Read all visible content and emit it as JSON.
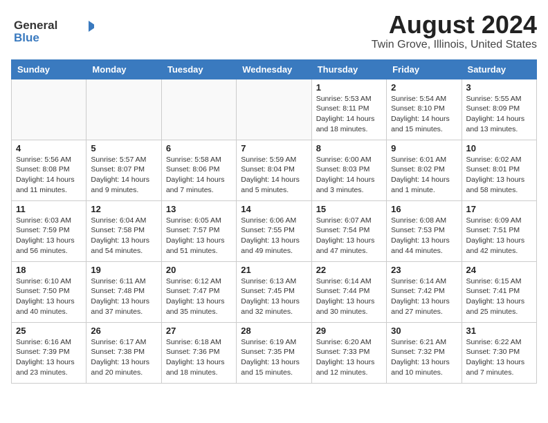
{
  "header": {
    "month_year": "August 2024",
    "location": "Twin Grove, Illinois, United States",
    "logo_general": "General",
    "logo_blue": "Blue"
  },
  "days_of_week": [
    "Sunday",
    "Monday",
    "Tuesday",
    "Wednesday",
    "Thursday",
    "Friday",
    "Saturday"
  ],
  "weeks": [
    [
      {
        "day": "",
        "info": ""
      },
      {
        "day": "",
        "info": ""
      },
      {
        "day": "",
        "info": ""
      },
      {
        "day": "",
        "info": ""
      },
      {
        "day": "1",
        "info": "Sunrise: 5:53 AM\nSunset: 8:11 PM\nDaylight: 14 hours\nand 18 minutes."
      },
      {
        "day": "2",
        "info": "Sunrise: 5:54 AM\nSunset: 8:10 PM\nDaylight: 14 hours\nand 15 minutes."
      },
      {
        "day": "3",
        "info": "Sunrise: 5:55 AM\nSunset: 8:09 PM\nDaylight: 14 hours\nand 13 minutes."
      }
    ],
    [
      {
        "day": "4",
        "info": "Sunrise: 5:56 AM\nSunset: 8:08 PM\nDaylight: 14 hours\nand 11 minutes."
      },
      {
        "day": "5",
        "info": "Sunrise: 5:57 AM\nSunset: 8:07 PM\nDaylight: 14 hours\nand 9 minutes."
      },
      {
        "day": "6",
        "info": "Sunrise: 5:58 AM\nSunset: 8:06 PM\nDaylight: 14 hours\nand 7 minutes."
      },
      {
        "day": "7",
        "info": "Sunrise: 5:59 AM\nSunset: 8:04 PM\nDaylight: 14 hours\nand 5 minutes."
      },
      {
        "day": "8",
        "info": "Sunrise: 6:00 AM\nSunset: 8:03 PM\nDaylight: 14 hours\nand 3 minutes."
      },
      {
        "day": "9",
        "info": "Sunrise: 6:01 AM\nSunset: 8:02 PM\nDaylight: 14 hours\nand 1 minute."
      },
      {
        "day": "10",
        "info": "Sunrise: 6:02 AM\nSunset: 8:01 PM\nDaylight: 13 hours\nand 58 minutes."
      }
    ],
    [
      {
        "day": "11",
        "info": "Sunrise: 6:03 AM\nSunset: 7:59 PM\nDaylight: 13 hours\nand 56 minutes."
      },
      {
        "day": "12",
        "info": "Sunrise: 6:04 AM\nSunset: 7:58 PM\nDaylight: 13 hours\nand 54 minutes."
      },
      {
        "day": "13",
        "info": "Sunrise: 6:05 AM\nSunset: 7:57 PM\nDaylight: 13 hours\nand 51 minutes."
      },
      {
        "day": "14",
        "info": "Sunrise: 6:06 AM\nSunset: 7:55 PM\nDaylight: 13 hours\nand 49 minutes."
      },
      {
        "day": "15",
        "info": "Sunrise: 6:07 AM\nSunset: 7:54 PM\nDaylight: 13 hours\nand 47 minutes."
      },
      {
        "day": "16",
        "info": "Sunrise: 6:08 AM\nSunset: 7:53 PM\nDaylight: 13 hours\nand 44 minutes."
      },
      {
        "day": "17",
        "info": "Sunrise: 6:09 AM\nSunset: 7:51 PM\nDaylight: 13 hours\nand 42 minutes."
      }
    ],
    [
      {
        "day": "18",
        "info": "Sunrise: 6:10 AM\nSunset: 7:50 PM\nDaylight: 13 hours\nand 40 minutes."
      },
      {
        "day": "19",
        "info": "Sunrise: 6:11 AM\nSunset: 7:48 PM\nDaylight: 13 hours\nand 37 minutes."
      },
      {
        "day": "20",
        "info": "Sunrise: 6:12 AM\nSunset: 7:47 PM\nDaylight: 13 hours\nand 35 minutes."
      },
      {
        "day": "21",
        "info": "Sunrise: 6:13 AM\nSunset: 7:45 PM\nDaylight: 13 hours\nand 32 minutes."
      },
      {
        "day": "22",
        "info": "Sunrise: 6:14 AM\nSunset: 7:44 PM\nDaylight: 13 hours\nand 30 minutes."
      },
      {
        "day": "23",
        "info": "Sunrise: 6:14 AM\nSunset: 7:42 PM\nDaylight: 13 hours\nand 27 minutes."
      },
      {
        "day": "24",
        "info": "Sunrise: 6:15 AM\nSunset: 7:41 PM\nDaylight: 13 hours\nand 25 minutes."
      }
    ],
    [
      {
        "day": "25",
        "info": "Sunrise: 6:16 AM\nSunset: 7:39 PM\nDaylight: 13 hours\nand 23 minutes."
      },
      {
        "day": "26",
        "info": "Sunrise: 6:17 AM\nSunset: 7:38 PM\nDaylight: 13 hours\nand 20 minutes."
      },
      {
        "day": "27",
        "info": "Sunrise: 6:18 AM\nSunset: 7:36 PM\nDaylight: 13 hours\nand 18 minutes."
      },
      {
        "day": "28",
        "info": "Sunrise: 6:19 AM\nSunset: 7:35 PM\nDaylight: 13 hours\nand 15 minutes."
      },
      {
        "day": "29",
        "info": "Sunrise: 6:20 AM\nSunset: 7:33 PM\nDaylight: 13 hours\nand 12 minutes."
      },
      {
        "day": "30",
        "info": "Sunrise: 6:21 AM\nSunset: 7:32 PM\nDaylight: 13 hours\nand 10 minutes."
      },
      {
        "day": "31",
        "info": "Sunrise: 6:22 AM\nSunset: 7:30 PM\nDaylight: 13 hours\nand 7 minutes."
      }
    ]
  ]
}
